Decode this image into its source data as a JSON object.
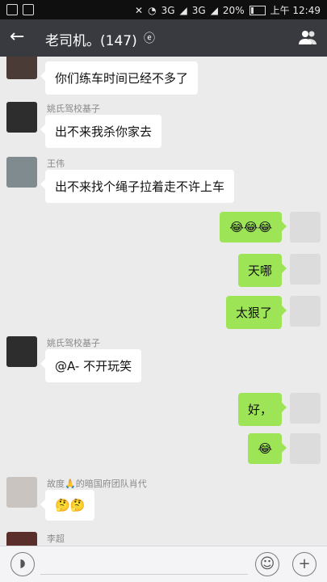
{
  "statusbar": {
    "battery": "20%",
    "time": "上午 12:49",
    "net1": "3G",
    "net2": "3G"
  },
  "header": {
    "back_icon": "back-arrow-icon",
    "title": "老司机。(147)",
    "ear_icon": "earpiece-icon",
    "group_icon": "group-members-icon"
  },
  "messages": [
    {
      "side": "left",
      "nick": "",
      "text": "你们练车时间已经不多了"
    },
    {
      "side": "left",
      "nick": "姚氏驾校基子",
      "text": "出不来我杀你家去"
    },
    {
      "side": "left",
      "nick": "王伟",
      "text": "出不来找个绳子拉着走不许上车"
    },
    {
      "side": "right",
      "nick": "",
      "text": "😂😂😂"
    },
    {
      "side": "right",
      "nick": "",
      "text": "天哪"
    },
    {
      "side": "right",
      "nick": "",
      "text": "太狠了"
    },
    {
      "side": "left",
      "nick": "姚氏驾校基子",
      "text": "@A- 不开玩笑"
    },
    {
      "side": "right",
      "nick": "",
      "text": "好，"
    },
    {
      "side": "right",
      "nick": "",
      "text": "😂"
    },
    {
      "side": "left",
      "nick": "故度🙏的暗国府团队肖代",
      "text": "🤔🤔"
    },
    {
      "side": "left",
      "nick": "李超",
      "text": ""
    }
  ],
  "input": {
    "voice_icon": "voice-toggle-icon",
    "emoji_icon": "emoji-icon",
    "plus_icon": "plus-icon"
  }
}
